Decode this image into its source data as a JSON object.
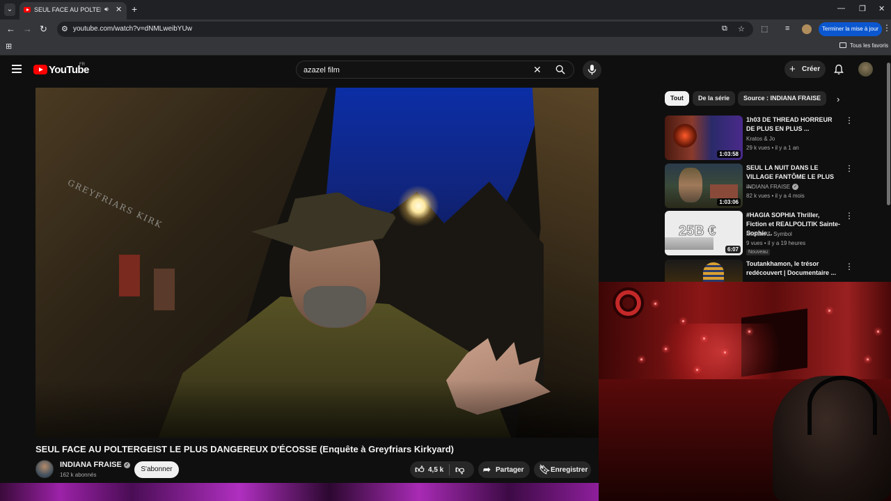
{
  "browser": {
    "tab_title": "SEUL FACE AU POLTERGEIST LE PLUS DANGEREUX D'ÉCOSSE",
    "url": "youtube.com/watch?v=dNMLweibYUw",
    "update_button": "Terminer la mise à jour",
    "bookmarks_all": "Tous les favoris"
  },
  "youtube": {
    "logo_text": "YouTube",
    "logo_country": "FR",
    "search_value": "azazel film",
    "create_label": "Créer"
  },
  "video": {
    "title": "SEUL FACE AU POLTERGEIST LE PLUS DANGEREUX D'ÉCOSSE (Enquête à Greyfriars Kirkyard)",
    "overlay_sign": "GREYFRIARS KIRK",
    "channel_name": "INDIANA FRAISE",
    "subscribers": "162 k abonnés",
    "subscribe_label": "S'abonner",
    "likes": "4,5 k",
    "share_label": "Partager",
    "save_label": "Enregistrer"
  },
  "chips": [
    "Tout",
    "De la série",
    "Source : INDIANA FRAISE"
  ],
  "recommendations": [
    {
      "title": "1h03 DE THREAD HORREUR DE PLUS EN PLUS ...",
      "channel": "Kratos & Jo",
      "verified": false,
      "meta": "29 k vues • il y a 1 an",
      "duration": "1:03:58",
      "badge": ""
    },
    {
      "title": "SEUL LA NUIT DANS LE VILLAGE FANTÔME LE PLUS ...",
      "channel": "INDIANA FRAISE",
      "verified": true,
      "meta": "82 k vues • il y a 4 mois",
      "duration": "1:03:06",
      "badge": ""
    },
    {
      "title": "#HAGIA SOPHIA Thriller, Fiction et REALPOLITIK Sainte-Sophie...",
      "channel": "Michael Z. Symbol",
      "verified": false,
      "meta": "9 vues • il y a 19 heures",
      "duration": "6:07",
      "thumb_text": "25B €",
      "badge": "Nouveau"
    },
    {
      "title": "Toutankhamon, le trésor redécouvert | Documentaire ...",
      "channel": "",
      "verified": false,
      "meta": "",
      "duration": "",
      "badge": ""
    }
  ],
  "colors": {
    "youtube_red": "#ff0000",
    "update_blue": "#0b57d0",
    "background": "#0f0f0f"
  }
}
